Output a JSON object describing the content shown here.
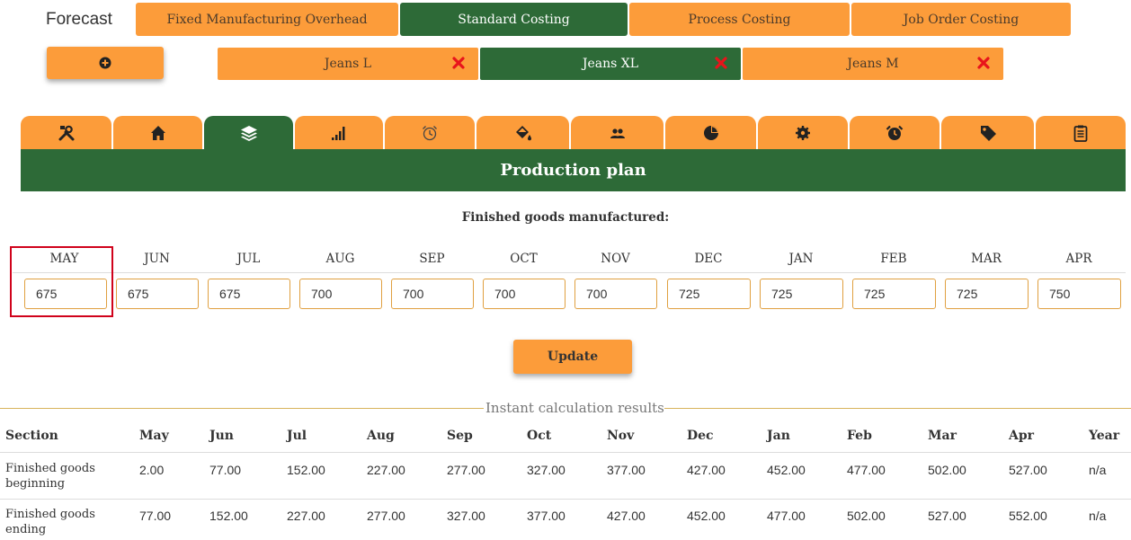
{
  "app": {
    "brand": "Forecast"
  },
  "nav": [
    {
      "label": "Fixed Manufacturing Overhead",
      "active": false
    },
    {
      "label": "Standard Costing",
      "active": true
    },
    {
      "label": "Process Costing",
      "active": false
    },
    {
      "label": "Job Order Costing",
      "active": false
    }
  ],
  "products": [
    {
      "label": "Jeans L",
      "active": false
    },
    {
      "label": "Jeans XL",
      "active": true
    },
    {
      "label": "Jeans M",
      "active": false
    }
  ],
  "icon_tabs": [
    {
      "icon": "tools-icon"
    },
    {
      "icon": "home-icon"
    },
    {
      "icon": "layers-icon",
      "active": true
    },
    {
      "icon": "signal-bars-icon"
    },
    {
      "icon": "alarm-clock-outline-icon"
    },
    {
      "icon": "paint-bucket-icon"
    },
    {
      "icon": "users-icon"
    },
    {
      "icon": "pie-chart-icon"
    },
    {
      "icon": "gear-icon"
    },
    {
      "icon": "alarm-clock-icon"
    },
    {
      "icon": "tag-icon"
    },
    {
      "icon": "clipboard-icon"
    }
  ],
  "section_title": "Production plan",
  "subtitle": "Finished goods manufactured:",
  "months": [
    {
      "label": "MAY",
      "value": "675"
    },
    {
      "label": "JUN",
      "value": "675"
    },
    {
      "label": "JUL",
      "value": "675"
    },
    {
      "label": "AUG",
      "value": "700"
    },
    {
      "label": "SEP",
      "value": "700"
    },
    {
      "label": "OCT",
      "value": "700"
    },
    {
      "label": "NOV",
      "value": "700"
    },
    {
      "label": "DEC",
      "value": "725"
    },
    {
      "label": "JAN",
      "value": "725"
    },
    {
      "label": "FEB",
      "value": "725"
    },
    {
      "label": "MAR",
      "value": "725"
    },
    {
      "label": "APR",
      "value": "750"
    }
  ],
  "update_label": "Update",
  "results": {
    "legend": "Instant calculation results",
    "headers": [
      "Section",
      "May",
      "Jun",
      "Jul",
      "Aug",
      "Sep",
      "Oct",
      "Nov",
      "Dec",
      "Jan",
      "Feb",
      "Mar",
      "Apr",
      "Year"
    ],
    "rows": [
      {
        "label": "Finished goods beginning",
        "values": [
          "2.00",
          "77.00",
          "152.00",
          "227.00",
          "277.00",
          "327.00",
          "377.00",
          "427.00",
          "452.00",
          "477.00",
          "502.00",
          "527.00",
          "n/a"
        ]
      },
      {
        "label": "Finished goods ending",
        "values": [
          "77.00",
          "152.00",
          "227.00",
          "277.00",
          "327.00",
          "377.00",
          "427.00",
          "452.00",
          "477.00",
          "502.00",
          "527.00",
          "552.00",
          "n/a"
        ]
      }
    ]
  },
  "colors": {
    "orange": "#fc9c3a",
    "green": "#2d6a37",
    "remove": "#e8141b",
    "highlight": "#d0021b"
  }
}
